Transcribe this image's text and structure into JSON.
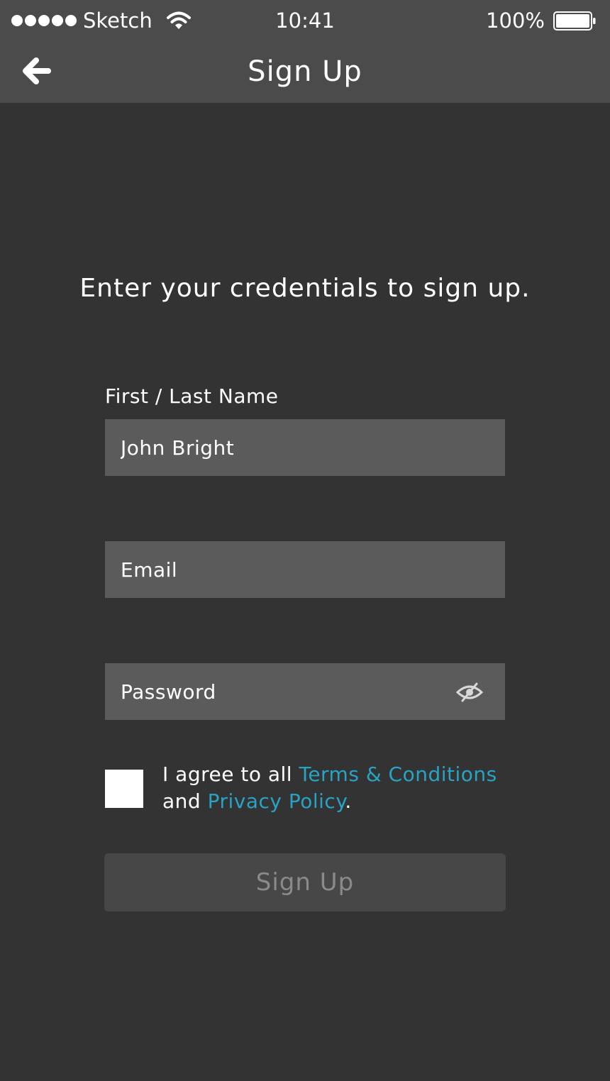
{
  "status_bar": {
    "carrier": "Sketch",
    "time": "10:41",
    "battery_percent": "100%"
  },
  "nav": {
    "back_icon": "arrow-left-icon",
    "title": "Sign Up"
  },
  "intro_text": "Enter your credentials to sign up.",
  "form": {
    "name_label": "First / Last Name",
    "name_value": "John Bright",
    "email_placeholder": "Email",
    "password_placeholder": "Password",
    "password_toggle_icon": "eye-hidden-icon",
    "agree_prefix": "I agree to all ",
    "terms_link": "Terms & Conditions",
    "agree_middle": "and ",
    "privacy_link": "Privacy Policy",
    "agree_suffix": ".",
    "checkbox_checked": false,
    "submit_label": "Sign Up"
  },
  "colors": {
    "background": "#333333",
    "header": "#4b4b4b",
    "field": "#5b5b5b",
    "link": "#29a3c4",
    "button": "#474747",
    "button_text": "#8a8a8a"
  }
}
